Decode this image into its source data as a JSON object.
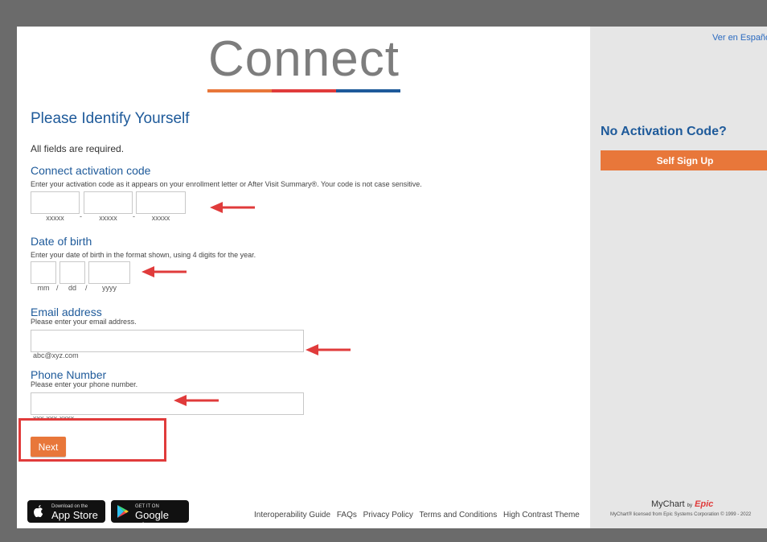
{
  "logo": {
    "text": "Connect"
  },
  "page": {
    "title": "Please Identify Yourself",
    "required_note": "All fields are required."
  },
  "activation": {
    "label": "Connect activation code",
    "help": "Enter your activation code as it appears on your enrollment letter or After Visit Summary®. Your code is not case sensitive.",
    "hints": [
      "xxxxx",
      "xxxxx",
      "xxxxx"
    ],
    "separator": "-"
  },
  "dob": {
    "label": "Date of birth",
    "help": "Enter your date of birth in the format shown, using 4 digits for the year.",
    "hints": [
      "mm",
      "dd",
      "yyyy"
    ],
    "separator": "/"
  },
  "email": {
    "label": "Email address",
    "help": "Please enter your email address.",
    "hint": "abc@xyz.com"
  },
  "phone": {
    "label": "Phone Number",
    "help": "Please enter your phone number.",
    "hint": "xxx-xxx-xxxx"
  },
  "actions": {
    "next_label": "Next"
  },
  "stores": {
    "apple": {
      "small": "Download on the",
      "big": "App Store"
    },
    "google": {
      "small": "GET IT ON",
      "big": "Google Play"
    }
  },
  "footer": {
    "links": [
      "Interoperability Guide",
      "FAQs",
      "Privacy Policy",
      "Terms and Conditions",
      "High Contrast Theme"
    ]
  },
  "sidebar": {
    "language_link": "Ver en Español",
    "no_code_heading": "No Activation Code?",
    "signup_label": "Self Sign Up",
    "brand_mychart": "MyChart",
    "brand_by": "by",
    "brand_epic": "Epic",
    "license": "MyChart® licensed from Epic Systems Corporation © 1999 - 2022"
  },
  "colors": {
    "heading_blue": "#1e5a9a",
    "accent_orange": "#e8773a",
    "annotation_red": "#e03b3b",
    "logo_gray": "#7d7d7d",
    "link_blue": "#2a6ac0"
  }
}
